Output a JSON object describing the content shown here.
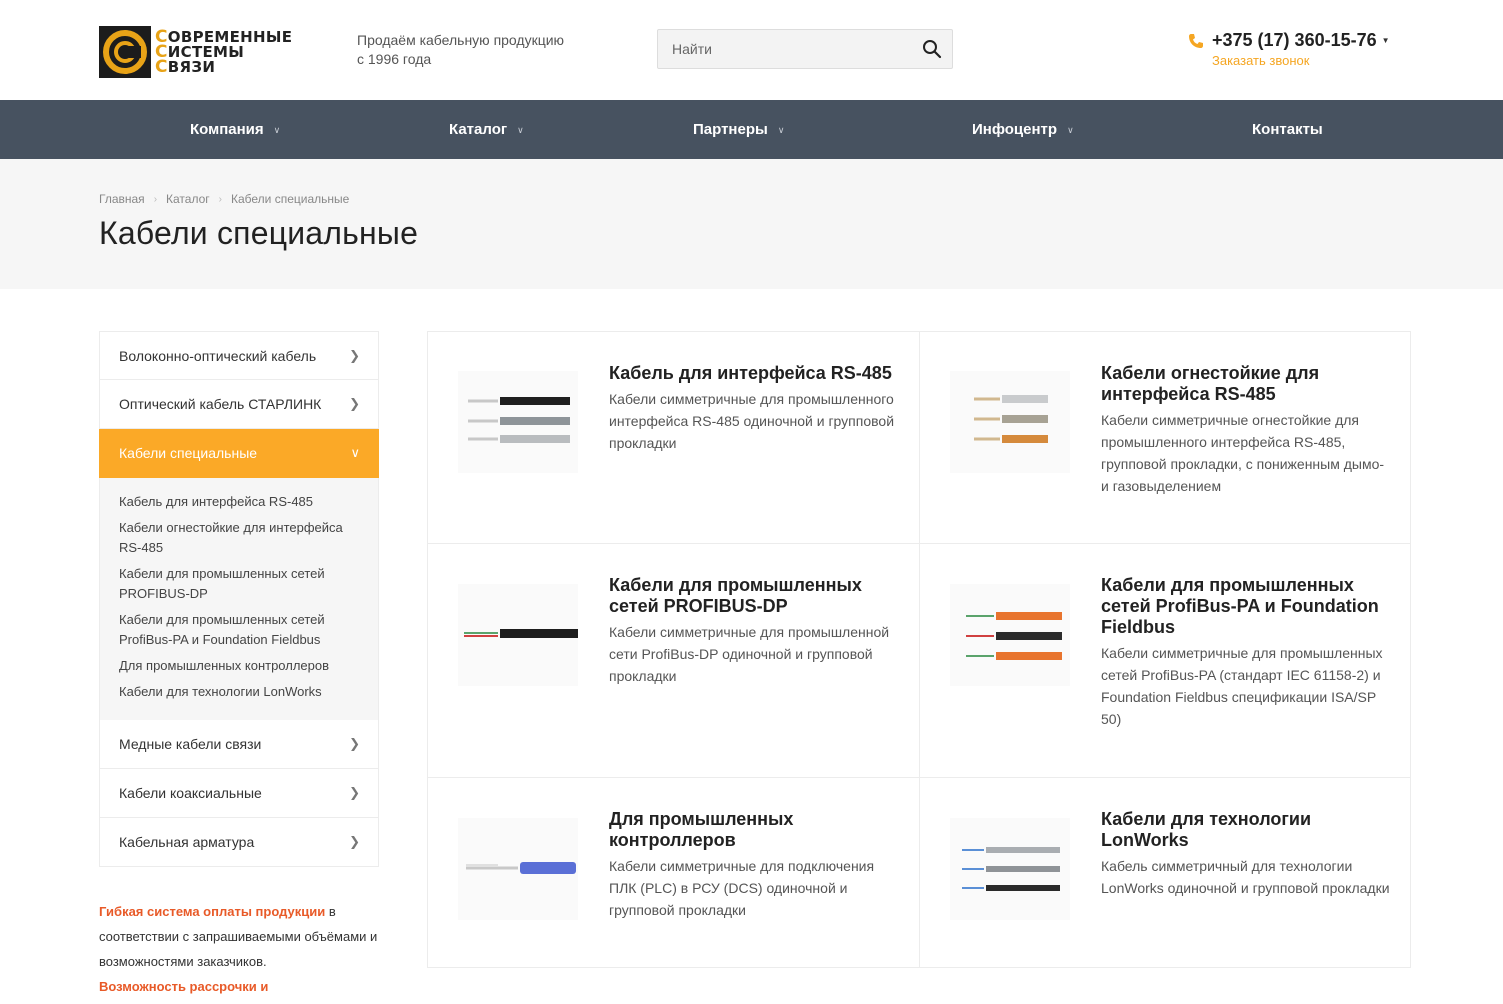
{
  "header": {
    "logo": {
      "lines": [
        [
          "С",
          "ОВРЕМЕННЫЕ"
        ],
        [
          "С",
          "ИСТЕМЫ"
        ],
        [
          "С",
          "ВЯЗИ"
        ]
      ]
    },
    "tagline_line1": "Продаём кабельную продукцию",
    "tagline_line2": "с 1996 года",
    "search": {
      "placeholder": "Найти",
      "icon": "search-icon"
    },
    "phone": {
      "number": "+375 (17) 360-15-76",
      "callback": "Заказать звонок",
      "icon": "phone-icon"
    }
  },
  "nav": {
    "items": [
      {
        "label": "Компания",
        "dropdown": true
      },
      {
        "label": "Каталог",
        "dropdown": true
      },
      {
        "label": "Партнеры",
        "dropdown": true
      },
      {
        "label": "Инфоцентр",
        "dropdown": true
      },
      {
        "label": "Контакты",
        "dropdown": false
      }
    ]
  },
  "breadcrumb": {
    "items": [
      "Главная",
      "Каталог",
      "Кабели специальные"
    ]
  },
  "page_title": "Кабели специальные",
  "sidebar": {
    "items_top": [
      {
        "label": "Волоконно-оптический кабель"
      },
      {
        "label": "Оптический кабель СТАРЛИНК"
      }
    ],
    "active": {
      "label": "Кабели специальные"
    },
    "submenu": [
      "Кабель для интерфейса RS-485",
      "Кабели огнестойкие для интерфейса RS-485",
      "Кабели для промышленных сетей PROFIBUS-DP",
      "Кабели для промышленных сетей ProfiBus-PA и Foundation Fieldbus",
      "Для промышленных контроллеров",
      "Кабели для технологии LonWorks"
    ],
    "items_bottom": [
      {
        "label": "Медные кабели связи"
      },
      {
        "label": "Кабели коаксиальные"
      },
      {
        "label": "Кабельная арматура"
      }
    ]
  },
  "promo": {
    "highlight1": "Гибкая система оплаты продукции",
    "text1": " в соответствии с запрашиваемыми объёмами и возможностями заказчиков.",
    "highlight2": "Возможность рассрочки и"
  },
  "products": [
    {
      "title": "Кабель для интерфейса RS-485",
      "desc": "Кабели симметричные для промышленного интерфейса RS-485 одиночной и групповой прокладки",
      "colors": [
        "#1f1f1f",
        "#8e9499",
        "#b9bcbf"
      ]
    },
    {
      "title": "Кабели огнестойкие для интерфейса RS-485",
      "desc": "Кабели симметричные огнестойкие для промышленного интерфейса RS-485, групповой прокладки, с пониженным дымо- и газовыделением",
      "colors": [
        "#c9cbcd",
        "#a7a294",
        "#d58a3c"
      ]
    },
    {
      "title": "Кабели для промышленных сетей PROFIBUS-DP",
      "desc": "Кабели симметричные для промышленной сети ProfiBus-DP одиночной и групповой прокладки",
      "colors": [
        "#1d1d1d"
      ]
    },
    {
      "title": "Кабели для промышленных сетей ProfiBus-PA и Foundation Fieldbus",
      "desc": "Кабели симметричные для промышленных сетей ProfiBus-PA (стандарт IEC 61158-2) и Foundation Fieldbus спецификации ISA/SP 50)",
      "colors": [
        "#e8742e",
        "#2b2b2b",
        "#e8742e"
      ]
    },
    {
      "title": "Для промышленных контроллеров",
      "desc": "Кабели симметричные для подключения ПЛК (PLC) в РСУ (DCS) одиночной и групповой прокладки",
      "colors": [
        "#5a6fd6"
      ]
    },
    {
      "title": "Кабели для технологии LonWorks",
      "desc": "Кабель симметричный для технологии LonWorks одиночной и групповой прокладки",
      "colors": [
        "#a9adb1",
        "#8f9397",
        "#2a2a2a"
      ]
    }
  ],
  "colors": {
    "accent": "#fba927",
    "nav_bg": "#475260",
    "promo": "#e85a28",
    "link": "#f5a623"
  }
}
